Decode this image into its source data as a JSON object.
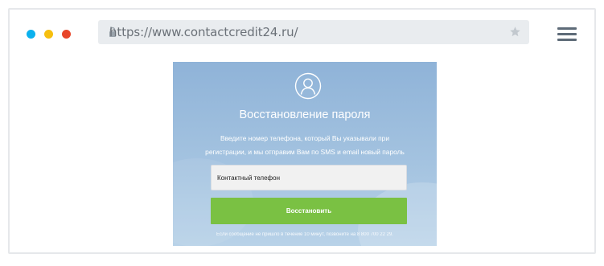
{
  "browser": {
    "url": "https://www.contactcredit24.ru/",
    "dots": {
      "blue": "#0bb1ee",
      "yellow": "#f6bf0f",
      "red": "#e8462a"
    },
    "icons": [
      "lock-icon",
      "star-icon",
      "menu-icon"
    ]
  },
  "recovery": {
    "icon": "user-icon",
    "title": "Восстановление пароля",
    "description_line1": "Введите номер телефона, который Вы указывали при",
    "description_line2": "регистрации, и мы отправим Вам по SMS и email новый пароль",
    "phone_placeholder": "Контактный телефон",
    "submit_label": "Восстановить",
    "footnote": "Если сообщение не пришло в течение 10 минут, позвоните на 8 800 700 22 29."
  },
  "colors": {
    "accent_green": "#7ac143",
    "card_blue": "#9fbfdf"
  }
}
